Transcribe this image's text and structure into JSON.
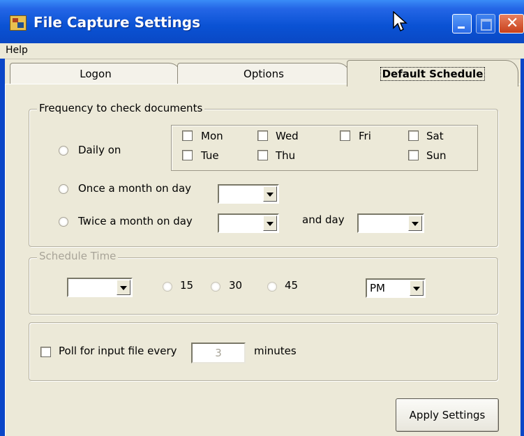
{
  "window": {
    "title": "File Capture Settings"
  },
  "menu": {
    "help": "Help"
  },
  "tabs": {
    "logon": "Logon",
    "options": "Options",
    "default_schedule": "Default Schedule"
  },
  "frequency": {
    "legend": "Frequency to check documents",
    "daily_label": "Daily on",
    "days": {
      "mon": "Mon",
      "tue": "Tue",
      "wed": "Wed",
      "thu": "Thu",
      "fri": "Fri",
      "sat": "Sat",
      "sun": "Sun"
    },
    "monthly_label": "Once a month on day",
    "monthly_day": "",
    "twice_label": "Twice a month on day",
    "twice_day1": "",
    "and_day_label": "and day",
    "twice_day2": ""
  },
  "schedule_time": {
    "legend": "Schedule Time",
    "hour": "",
    "m15": "15",
    "m30": "30",
    "m45": "45",
    "ampm": "PM"
  },
  "poll": {
    "label": "Poll for input file every",
    "value": "3",
    "unit": "minutes"
  },
  "apply_button": "Apply Settings"
}
